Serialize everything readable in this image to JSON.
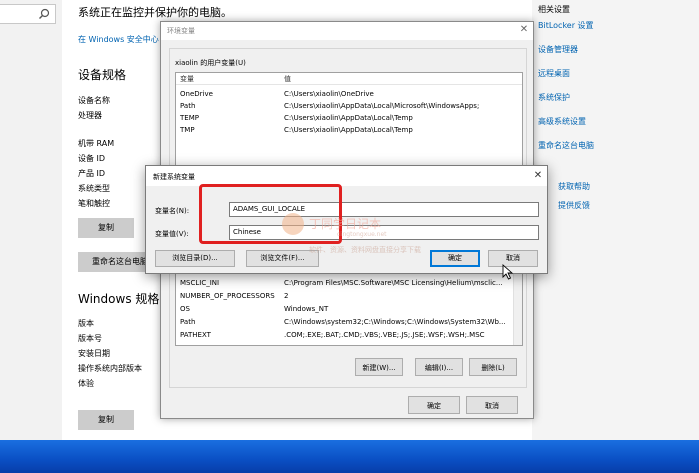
{
  "settings": {
    "protect_text": "系统正在监控并保护你的电脑。",
    "security_link": "在 Windows 安全中心",
    "device_specs": {
      "title": "设备规格",
      "labels": [
        "设备名称",
        "处理器",
        "机带 RAM",
        "设备 ID",
        "产品 ID",
        "系统类型",
        "笔和触控"
      ],
      "copy_button": "复制",
      "rename_button": "重命名这台电脑"
    },
    "windows_specs": {
      "title": "Windows 规格",
      "labels": [
        "版本",
        "版本号",
        "安装日期",
        "操作系统内部版本",
        "体验"
      ],
      "copy_button": "复制"
    },
    "related": {
      "title": "相关设置",
      "links": [
        "BitLocker 设置",
        "设备管理器",
        "远程桌面",
        "系统保护",
        "高级系统设置",
        "重命名这台电脑"
      ],
      "help_links": [
        "获取帮助",
        "提供反馈"
      ]
    }
  },
  "env_dialog": {
    "title": "环境变量",
    "user_vars_label": "xiaolin 的用户变量(U)",
    "col_variable": "变量",
    "col_value": "值",
    "user_vars": [
      {
        "name": "OneDrive",
        "value": "C:\\Users\\xiaolin\\OneDrive"
      },
      {
        "name": "Path",
        "value": "C:\\Users\\xiaolin\\AppData\\Local\\Microsoft\\WindowsApps;"
      },
      {
        "name": "TEMP",
        "value": "C:\\Users\\xiaolin\\AppData\\Local\\Temp"
      },
      {
        "name": "TMP",
        "value": "C:\\Users\\xiaolin\\AppData\\Local\\Temp"
      }
    ],
    "system_vars": [
      {
        "name": "MSCLIC_INI",
        "value": "C:\\Program Files\\MSC.Software\\MSC Licensing\\Helium\\msclic..."
      },
      {
        "name": "NUMBER_OF_PROCESSORS",
        "value": "2"
      },
      {
        "name": "OS",
        "value": "Windows_NT"
      },
      {
        "name": "Path",
        "value": "C:\\Windows\\system32;C:\\Windows;C:\\Windows\\System32\\Wb..."
      },
      {
        "name": "PATHEXT",
        "value": ".COM;.EXE;.BAT;.CMD;.VBS;.VBE;.JS;.JSE;.WSF;.WSH;.MSC"
      }
    ],
    "new_button": "新建(W)...",
    "edit_button": "编辑(I)...",
    "delete_button": "删除(L)",
    "ok_button": "确定",
    "cancel_button": "取消"
  },
  "new_var_dialog": {
    "title": "新建系统变量",
    "name_label": "变量名(N):",
    "name_value": "ADAMS_GUI_LOCALE",
    "value_label": "变量值(V):",
    "value_value": "Chinese",
    "browse_dir_button": "浏览目录(D)...",
    "browse_file_button": "浏览文件(F)...",
    "ok_button": "确定",
    "cancel_button": "取消"
  },
  "watermark": {
    "title": "丁同学日记本",
    "url": "dingtongxue.net",
    "subtitle": "软件、资源、资料网盘直接分享下载"
  },
  "colors": {
    "highlight": "#e02020",
    "link": "#0063b1",
    "taskbar": "#0a4fc4",
    "selection": "#cce8ff"
  }
}
